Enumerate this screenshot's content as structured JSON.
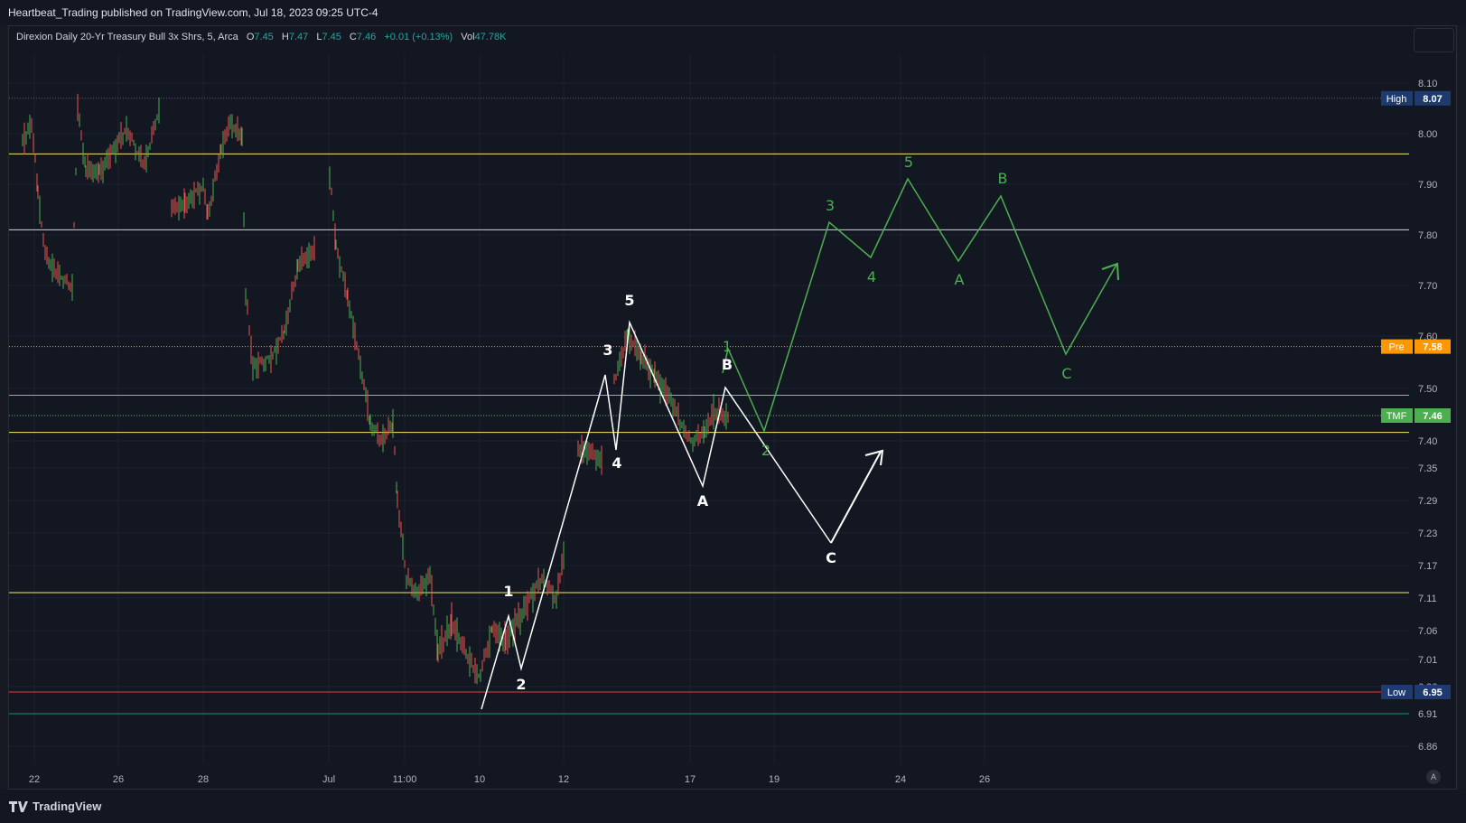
{
  "header": {
    "published_line": "Heartbeat_Trading published on TradingView.com, Jul 18, 2023 09:25 UTC-4"
  },
  "legend": {
    "symbol": "Direxion Daily 20-Yr Treasury Bull 3x Shrs, 5, Arca",
    "open_label": "O",
    "open": "7.45",
    "high_label": "H",
    "high": "7.47",
    "low_label": "L",
    "low": "7.45",
    "close_label": "C",
    "close": "7.46",
    "change": "+0.01 (+0.13%)",
    "vol_label": "Vol",
    "volume": "47.78K"
  },
  "footer": {
    "brand": "TradingView",
    "auto_label": "A"
  },
  "colors": {
    "bull": "#26a69a",
    "candle_up": "#4caf50",
    "candle_down": "#ef5350",
    "bg": "#131722",
    "white_path": "#ffffff",
    "green_path": "#4caf50",
    "yellow_line": "#f5e76c",
    "orange_line": "#ff9800",
    "red_line": "#f23645",
    "teal_line": "#089981"
  },
  "chart_data": {
    "type": "candlestick",
    "timeframe": "5",
    "y_axis": {
      "ticks": [
        "8.10",
        "8.00",
        "7.90",
        "7.80",
        "7.70",
        "7.60",
        "7.50",
        "7.46",
        "7.40",
        "7.35",
        "7.29",
        "7.23",
        "7.17",
        "7.11",
        "7.06",
        "7.01",
        "6.96",
        "6.91",
        "6.86"
      ]
    },
    "x_axis": {
      "ticks": [
        "22",
        "26",
        "28",
        "Jul",
        "11:00",
        "10",
        "12",
        "17",
        "19",
        "24",
        "26"
      ]
    },
    "price_labels": [
      {
        "tag": "High",
        "value": "8.07",
        "color": "#1e3a6e"
      },
      {
        "tag": "Pre",
        "value": "7.58",
        "color": "#ff9800"
      },
      {
        "tag": "TMF",
        "value": "7.46",
        "color": "#4caf50"
      },
      {
        "tag": "Low",
        "value": "6.95",
        "color": "#1e3a6e"
      }
    ],
    "horizontal_levels": [
      {
        "price": 7.96,
        "color": "yellow"
      },
      {
        "price": 7.81,
        "color": "white"
      },
      {
        "price": 7.49,
        "color": "orange"
      },
      {
        "price": 7.42,
        "color": "yellow"
      },
      {
        "price": 7.12,
        "color": "yellow"
      },
      {
        "price": 6.95,
        "color": "red"
      },
      {
        "price": 6.91,
        "color": "teal"
      }
    ],
    "wave_labels_white": [
      "1",
      "2",
      "3",
      "4",
      "5",
      "A",
      "B",
      "C"
    ],
    "wave_labels_green": [
      "1",
      "2",
      "3",
      "4",
      "5",
      "A",
      "B",
      "C"
    ]
  }
}
